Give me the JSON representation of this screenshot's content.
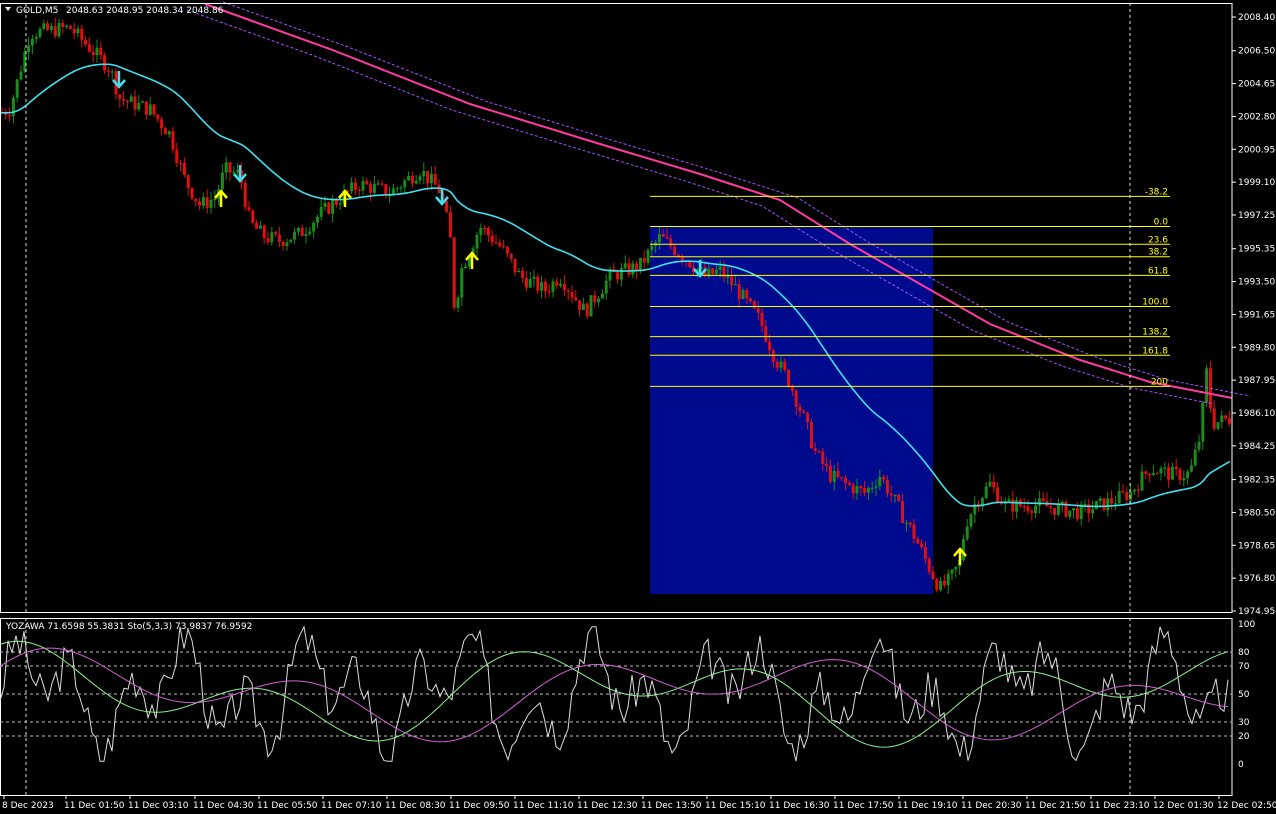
{
  "header": {
    "symbol_label": "GOLD,M5",
    "ohlc": "2048.63 2048.95 2048.34 2048.86"
  },
  "colors": {
    "background": "#000000",
    "bull": "#1a8c1a",
    "bear": "#e01010",
    "fast_ma": "#40e0f0",
    "slow_ma": "#ff3aa0",
    "fib": "#ffff00",
    "box": "#000a8c",
    "arrow_up": "#ffff00",
    "arrow_down": "#40e0f0",
    "osc_white": "#dcdcdc",
    "osc_green": "#8cf08c",
    "osc_magenta": "#d060d0"
  },
  "price_axis": [
    "2008.40",
    "2006.50",
    "2004.65",
    "2002.80",
    "2000.95",
    "1999.10",
    "1997.25",
    "1995.35",
    "1993.50",
    "1991.65",
    "1989.80",
    "1987.95",
    "1986.10",
    "1984.25",
    "1982.35",
    "1980.50",
    "1978.65",
    "1976.80",
    "1974.95"
  ],
  "fib_levels": [
    {
      "label": "-38.2",
      "price": 1998.3
    },
    {
      "label": "0.0",
      "price": 1996.6
    },
    {
      "label": "23.6",
      "price": 1995.6
    },
    {
      "label": "38.2",
      "price": 1994.9
    },
    {
      "label": "61.8",
      "price": 1993.85
    },
    {
      "label": "100.0",
      "price": 1992.1
    },
    {
      "label": "138.2",
      "price": 1990.4
    },
    {
      "label": "161.8",
      "price": 1989.35
    },
    {
      "label": "200",
      "price": 1987.6
    }
  ],
  "oscillator": {
    "title": "YOZAWA 71.6598 55.3831  Sto(5,3,3) 73.9837 76.9592",
    "axis": [
      "100",
      "80",
      "70",
      "50",
      "30",
      "20",
      "0"
    ]
  },
  "time_axis": [
    "8 Dec 2023",
    "11 Dec 01:50",
    "11 Dec 03:10",
    "11 Dec 04:30",
    "11 Dec 05:50",
    "11 Dec 07:10",
    "11 Dec 08:30",
    "11 Dec 09:50",
    "11 Dec 11:10",
    "11 Dec 12:30",
    "11 Dec 13:50",
    "11 Dec 15:10",
    "11 Dec 16:30",
    "11 Dec 17:50",
    "11 Dec 19:10",
    "11 Dec 20:30",
    "11 Dec 21:50",
    "11 Dec 23:10",
    "12 Dec 01:30",
    "12 Dec 02:50"
  ],
  "chart_data": {
    "type": "candlestick",
    "symbol": "GOLD",
    "timeframe": "M5",
    "ylim": [
      1974.95,
      2008.4
    ],
    "price_path_keypoints": [
      [
        0,
        2003.0
      ],
      [
        10,
        2003.2
      ],
      [
        30,
        2007.5
      ],
      [
        70,
        2007.8
      ],
      [
        110,
        2005.5
      ],
      [
        120,
        2003.8
      ],
      [
        150,
        2003.2
      ],
      [
        170,
        2001.8
      ],
      [
        185,
        1999.2
      ],
      [
        200,
        1997.8
      ],
      [
        215,
        1998.2
      ],
      [
        225,
        1999.8
      ],
      [
        240,
        1999.5
      ],
      [
        250,
        1996.8
      ],
      [
        265,
        1996.0
      ],
      [
        280,
        1995.8
      ],
      [
        300,
        1996.2
      ],
      [
        320,
        1997.3
      ],
      [
        340,
        1998.2
      ],
      [
        360,
        1999.0
      ],
      [
        390,
        1998.5
      ],
      [
        420,
        1999.8
      ],
      [
        440,
        1998.6
      ],
      [
        450,
        1996.2
      ],
      [
        455,
        1991.5
      ],
      [
        460,
        1994.0
      ],
      [
        480,
        1996.6
      ],
      [
        500,
        1995.5
      ],
      [
        520,
        1993.8
      ],
      [
        545,
        1993.0
      ],
      [
        560,
        1993.8
      ],
      [
        585,
        1991.8
      ],
      [
        610,
        1993.8
      ],
      [
        640,
        1994.4
      ],
      [
        660,
        1996.0
      ],
      [
        690,
        1994.6
      ],
      [
        705,
        1993.8
      ],
      [
        720,
        1994.1
      ],
      [
        735,
        1993.2
      ],
      [
        760,
        1991.3
      ],
      [
        775,
        1989.2
      ],
      [
        790,
        1987.8
      ],
      [
        805,
        1985.6
      ],
      [
        815,
        1983.9
      ],
      [
        830,
        1982.6
      ],
      [
        845,
        1982.1
      ],
      [
        865,
        1981.6
      ],
      [
        880,
        1982.6
      ],
      [
        900,
        1980.6
      ],
      [
        915,
        1979.1
      ],
      [
        930,
        1977.3
      ],
      [
        940,
        1976.2
      ],
      [
        950,
        1976.7
      ],
      [
        960,
        1977.7
      ],
      [
        965,
        1979.8
      ],
      [
        975,
        1981.0
      ],
      [
        990,
        1982.1
      ],
      [
        1005,
        1980.9
      ],
      [
        1040,
        1980.9
      ],
      [
        1080,
        1980.5
      ],
      [
        1110,
        1981.1
      ],
      [
        1130,
        1981.6
      ],
      [
        1150,
        1983.0
      ],
      [
        1175,
        1982.6
      ],
      [
        1190,
        1982.7
      ],
      [
        1200,
        1984.8
      ],
      [
        1207,
        1988.6
      ],
      [
        1212,
        1985.5
      ],
      [
        1230,
        1985.8
      ]
    ],
    "signal_arrows": [
      {
        "dir": "down",
        "time": "11 Dec 02:30"
      },
      {
        "dir": "up",
        "time": "11 Dec 04:40"
      },
      {
        "dir": "down",
        "time": "11 Dec 05:00"
      },
      {
        "dir": "up",
        "time": "11 Dec 07:20"
      },
      {
        "dir": "down",
        "time": "11 Dec 09:20"
      },
      {
        "dir": "up",
        "time": "11 Dec 09:50"
      },
      {
        "dir": "down",
        "time": "11 Dec 14:50"
      },
      {
        "dir": "up",
        "time": "11 Dec 19:30"
      }
    ]
  }
}
